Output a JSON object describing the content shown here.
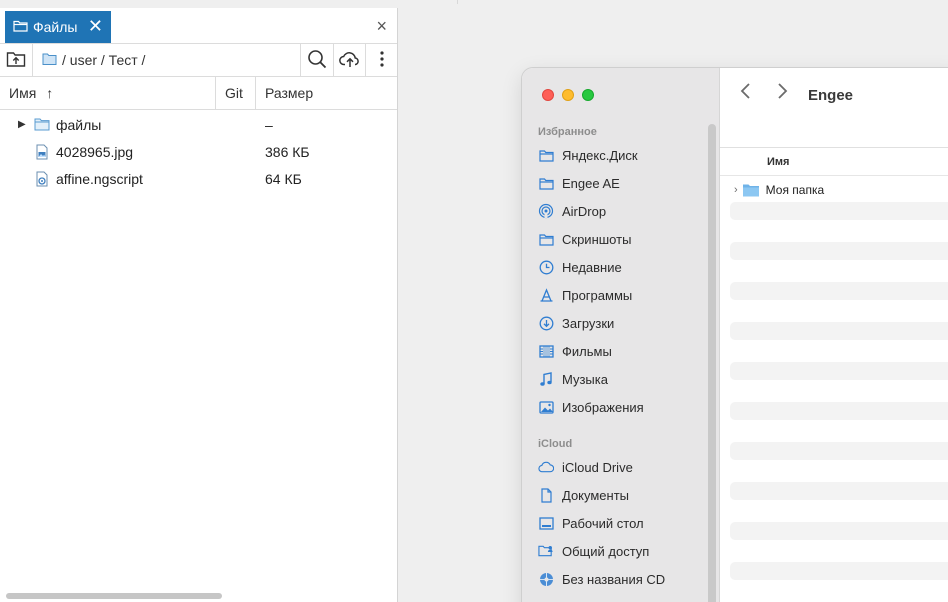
{
  "file_browser": {
    "tab": {
      "label": "Файлы",
      "close_symbol": "✕"
    },
    "panel_close_symbol": "×",
    "path": "/ user / Тест /",
    "columns": {
      "name": "Имя",
      "git": "Git",
      "size": "Размер",
      "sort_symbol": "↑"
    },
    "rows": [
      {
        "name": "файлы",
        "git": "",
        "size": "–",
        "icon": "folder-icon",
        "expandable": true
      },
      {
        "name": "4028965.jpg",
        "git": "",
        "size": "386 КБ",
        "icon": "image-file-icon",
        "expandable": false
      },
      {
        "name": "affine.ngscript",
        "git": "",
        "size": "64 КБ",
        "icon": "script-file-icon",
        "expandable": false
      }
    ]
  },
  "finder": {
    "title": "Engee",
    "back_symbol": "‹",
    "forward_symbol": "›",
    "favorites_header": "Избранное",
    "favorites": [
      {
        "label": "Яндекс.Диск",
        "icon": "folder-icon"
      },
      {
        "label": "Engee AE",
        "icon": "folder-icon"
      },
      {
        "label": "AirDrop",
        "icon": "airdrop-icon"
      },
      {
        "label": "Скриншоты",
        "icon": "folder-icon"
      },
      {
        "label": "Недавние",
        "icon": "clock-icon"
      },
      {
        "label": "Программы",
        "icon": "apps-icon"
      },
      {
        "label": "Загрузки",
        "icon": "download-icon"
      },
      {
        "label": "Фильмы",
        "icon": "film-icon"
      },
      {
        "label": "Музыка",
        "icon": "music-icon"
      },
      {
        "label": "Изображения",
        "icon": "photo-icon"
      }
    ],
    "icloud_header": "iCloud",
    "icloud": [
      {
        "label": "iCloud Drive",
        "icon": "cloud-icon"
      },
      {
        "label": "Документы",
        "icon": "document-icon"
      },
      {
        "label": "Рабочий стол",
        "icon": "desktop-icon"
      },
      {
        "label": "Общий доступ",
        "icon": "shared-folder-icon"
      },
      {
        "label": "Без названия CD",
        "icon": "disc-icon"
      }
    ],
    "column_header": "Имя",
    "items": [
      {
        "name": "Моя папка",
        "icon": "folder-icon"
      }
    ]
  },
  "colors": {
    "tab_accent": "#1f74b5",
    "folder_blue": "#5ba8e0",
    "finder_sidebar_icon": "#2f7dd1"
  }
}
